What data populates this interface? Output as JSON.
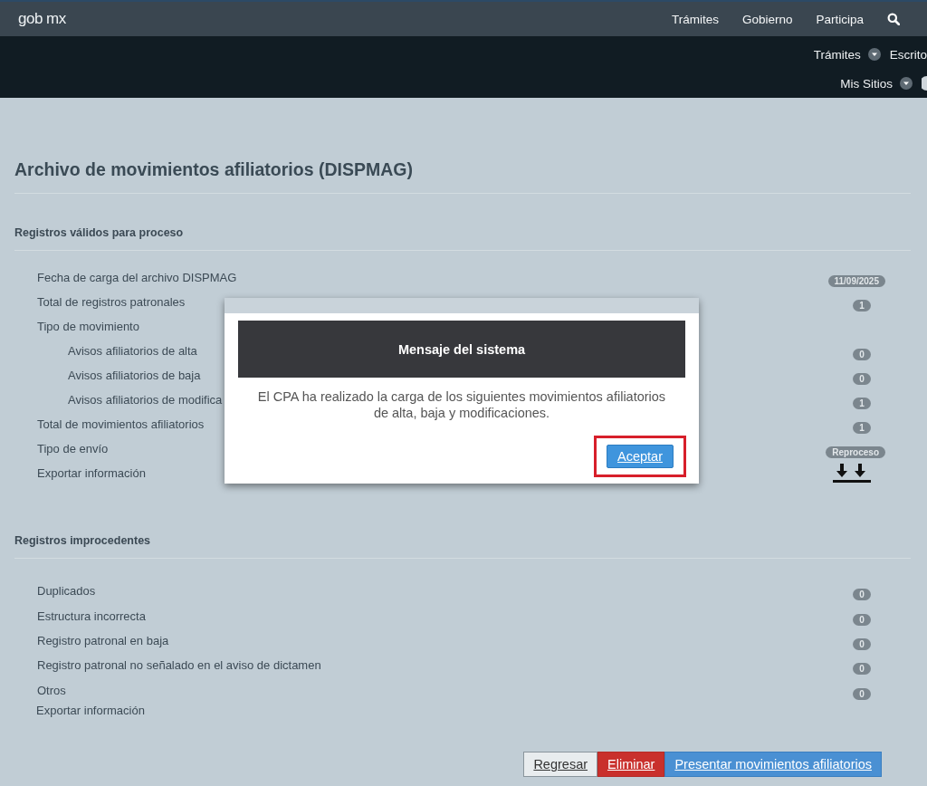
{
  "header": {
    "logo": "gob mx",
    "nav": [
      "Trámites",
      "Gobierno",
      "Participa"
    ],
    "subnav": [
      [
        {
          "label": "Trámites",
          "caret": true
        },
        {
          "label": "Escrito",
          "caret": false
        }
      ],
      [
        {
          "label": "Mis Sitios",
          "caret": true
        }
      ]
    ]
  },
  "title": "Archivo de movimientos afiliatorios (DISPMAG)",
  "sections": [
    {
      "title": "Registros válidos para proceso",
      "rows": [
        {
          "kind": "value",
          "label": "Fecha de carga del archivo DISPMAG",
          "badge": "11/09/2025"
        },
        {
          "kind": "value",
          "label": "Total de registros patronales",
          "badge": "1"
        },
        {
          "kind": "group",
          "label": "Tipo de movimiento",
          "children": [
            {
              "kind": "value",
              "label": "Avisos afiliatorios de alta",
              "badge": "0"
            },
            {
              "kind": "value",
              "label": "Avisos afiliatorios de baja",
              "badge": "0"
            },
            {
              "kind": "value",
              "label": "Avisos afiliatorios de modifica",
              "badge": "1"
            }
          ]
        },
        {
          "kind": "value",
          "label": "Total de movimientos afiliatorios",
          "badge": "1"
        },
        {
          "kind": "value",
          "label": "Tipo de envío",
          "badge": "Reproceso"
        },
        {
          "kind": "export",
          "label": "Exportar información"
        }
      ]
    },
    {
      "title": "Registros improcedentes",
      "rows": [
        {
          "kind": "value",
          "label": "Duplicados",
          "badge": "0"
        },
        {
          "kind": "value",
          "label": "Estructura incorrecta",
          "badge": "0"
        },
        {
          "kind": "value",
          "label": "Registro patronal en baja",
          "badge": "0"
        },
        {
          "kind": "value",
          "label": "Registro patronal no señalado en el aviso de dictamen",
          "badge": "0"
        },
        {
          "kind": "value",
          "label": "Otros",
          "badge": "0"
        },
        {
          "kind": "text",
          "label": "Exportar información"
        }
      ]
    }
  ],
  "buttons": [
    {
      "label": "Regresar",
      "kind": "default"
    },
    {
      "label": "Eliminar",
      "kind": "danger"
    },
    {
      "label": "Presentar movimientos afiliatorios",
      "kind": "primary"
    }
  ],
  "modal": {
    "title": "Mensaje del sistema",
    "message": "El CPA ha realizado la carga de los siguientes movimientos afiliatorios de alta, baja y modificaciones.",
    "button": "Aceptar",
    "highlighted": true
  }
}
